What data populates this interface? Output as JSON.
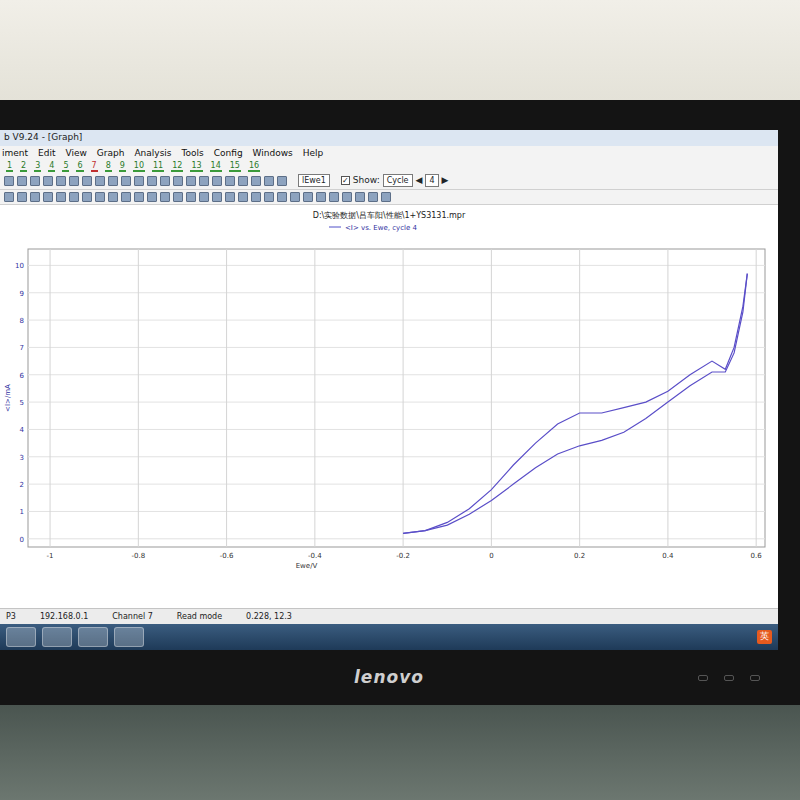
{
  "window": {
    "title": "b V9.24 - [Graph]"
  },
  "menu": [
    "iment",
    "Edit",
    "View",
    "Graph",
    "Analysis",
    "Tools",
    "Config",
    "Windows",
    "Help"
  ],
  "channel_tabs": [
    {
      "label": "1",
      "selected": false
    },
    {
      "label": "2",
      "selected": false
    },
    {
      "label": "3",
      "selected": false
    },
    {
      "label": "4",
      "selected": false
    },
    {
      "label": "5",
      "selected": false
    },
    {
      "label": "6",
      "selected": false
    },
    {
      "label": "7",
      "selected": true
    },
    {
      "label": "8",
      "selected": false
    },
    {
      "label": "9",
      "selected": false
    },
    {
      "label": "10",
      "selected": false
    },
    {
      "label": "11",
      "selected": false
    },
    {
      "label": "12",
      "selected": false
    },
    {
      "label": "13",
      "selected": false
    },
    {
      "label": "14",
      "selected": false
    },
    {
      "label": "15",
      "selected": false
    },
    {
      "label": "16",
      "selected": false
    }
  ],
  "toolbar": {
    "trace_select": "lEwe1",
    "show_checked": true,
    "show_label": "Show:",
    "show_select": "Cycle",
    "cycle": "4",
    "prev": "◀",
    "next": "▶",
    "checkmark": "✓"
  },
  "chart": {
    "title": "D:\\实验数据\\吕车阳\\性能\\1+YS3131.mpr",
    "legend": "<I> vs. Ewe, cycle 4",
    "y_label": "<I>/mA",
    "x_label": "Ewe/V",
    "y_ticks": [
      "0",
      "1",
      "2",
      "3",
      "4",
      "5",
      "6",
      "7",
      "8",
      "9",
      "10"
    ],
    "x_ticks": [
      "-1",
      "-0.8",
      "-0.6",
      "-0.4",
      "-0.2",
      "0",
      "0.2",
      "0.4",
      "0.6"
    ],
    "series": [
      {
        "name": "upper",
        "x": [
          -0.2,
          -0.15,
          -0.1,
          -0.05,
          0,
          0.05,
          0.1,
          0.15,
          0.2,
          0.25,
          0.3,
          0.35,
          0.4,
          0.45,
          0.5,
          0.53,
          0.55,
          0.57,
          0.58
        ],
        "y": [
          0.2,
          0.3,
          0.6,
          1.1,
          1.8,
          2.7,
          3.5,
          4.2,
          4.6,
          4.6,
          4.8,
          5.0,
          5.4,
          6.0,
          6.5,
          6.2,
          7.0,
          8.5,
          9.7
        ]
      },
      {
        "name": "lower",
        "x": [
          -0.2,
          -0.15,
          -0.1,
          -0.05,
          0,
          0.05,
          0.1,
          0.15,
          0.2,
          0.25,
          0.3,
          0.35,
          0.4,
          0.45,
          0.5,
          0.53,
          0.55,
          0.57,
          0.58
        ],
        "y": [
          0.2,
          0.3,
          0.5,
          0.9,
          1.4,
          2.0,
          2.6,
          3.1,
          3.4,
          3.6,
          3.9,
          4.4,
          5.0,
          5.6,
          6.1,
          6.1,
          6.8,
          8.3,
          9.7
        ]
      }
    ]
  },
  "status_bar": [
    "P3",
    "192.168.0.1",
    "Channel 7",
    "Read mode",
    "0.228, 12.3"
  ],
  "tray": {
    "ime": "英"
  },
  "monitor": {
    "brand": "lenovo"
  }
}
